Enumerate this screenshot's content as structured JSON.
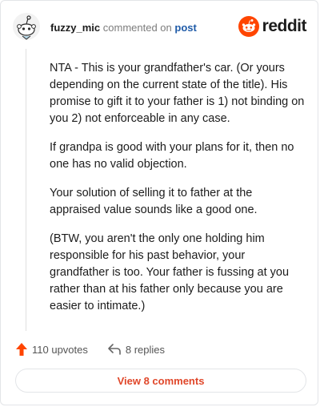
{
  "comment": {
    "username": "fuzzy_mic",
    "verb": "commented on",
    "post_link": "post",
    "paragraphs": [
      "NTA - This is your grandfather's car. (Or yours depending on the current state of the title). His promise to gift it to your father is 1) not binding on you 2) not enforceable in any case.",
      "If grandpa is good with your plans for it, then no one has no valid objection.",
      "Your solution of selling it to father at the appraised value sounds like a good one.",
      "(BTW, you aren't the only one holding him responsible for his past behavior, your grandfather is too. Your father is fussing at you rather than at his father only because you are easier to intimate.)"
    ]
  },
  "brand": {
    "name": "reddit",
    "color": "#ff4500"
  },
  "actions": {
    "upvotes": "110 upvotes",
    "replies": "8 replies",
    "upvote_color": "#ff4500"
  },
  "footer": {
    "view_comments": "View 8 comments"
  },
  "icons": {
    "avatar": "snoo-avatar-icon",
    "logo": "reddit-logo-icon",
    "upvote": "upvote-arrow-icon",
    "reply": "reply-arrow-icon"
  }
}
